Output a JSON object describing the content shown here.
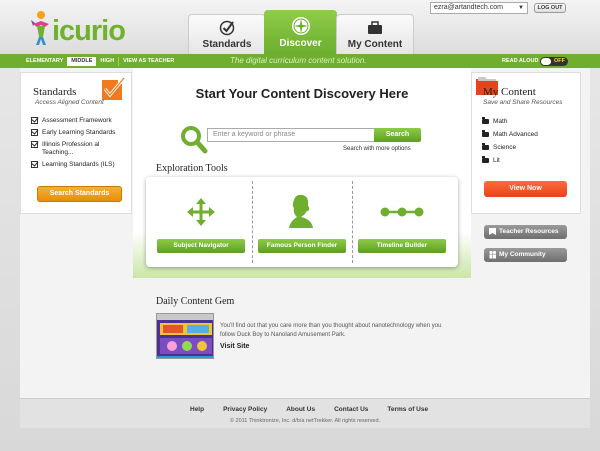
{
  "header": {
    "logo_text": "icurio",
    "tabs": [
      {
        "label": "Standards",
        "icon": "checkmark-circle-icon"
      },
      {
        "label": "Discover",
        "icon": "compass-icon"
      },
      {
        "label": "My Content",
        "icon": "briefcase-icon"
      }
    ],
    "account_email": "ezra@artandtech.com",
    "logout_label": "LOG OUT"
  },
  "levelbar": {
    "levels": [
      "ELEMENTARY",
      "MIDDLE",
      "HIGH",
      "VIEW AS TEACHER"
    ],
    "active_level": "MIDDLE",
    "tagline": "The digital curriculum content solution.",
    "read_aloud_label": "READ ALOUD",
    "read_aloud_state": "OFF"
  },
  "standards_panel": {
    "title": "Standards",
    "subtitle": "Access Aligned Content",
    "items": [
      "Assessment Framework",
      "Early Learning Standards",
      "Illinois Profession al Teaching...",
      "Learning Standards (ILS)"
    ],
    "button_label": "Search Standards"
  },
  "discover": {
    "heading": "Start Your Content Discovery Here",
    "search_placeholder": "Enter a keyword or phrase",
    "search_button": "Search",
    "search_more": "Search with more options",
    "tools_title": "Exploration Tools",
    "tools": [
      {
        "label": "Subject Navigator",
        "icon": "four-arrows-icon"
      },
      {
        "label": "Famous Person Finder",
        "icon": "person-silhouette-icon"
      },
      {
        "label": "Timeline Builder",
        "icon": "timeline-icon"
      }
    ]
  },
  "gem": {
    "title": "Daily Content Gem",
    "text": "You'll find out that you care more than you thought about nanotechnology when you follow Duck Boy to Nanoland Amusement Park.",
    "link_label": "Visit Site"
  },
  "my_content_panel": {
    "title": "My Content",
    "subtitle": "Save and Share Resources",
    "folders": [
      "Math",
      "Math Advanced",
      "Science",
      "Lit"
    ],
    "view_button": "View Now",
    "teacher_resources": "Teacher Resources",
    "my_community": "My Community"
  },
  "footer": {
    "links": [
      "Help",
      "Privacy Policy",
      "About Us",
      "Contact Us",
      "Terms of Use"
    ],
    "copyright": "© 2011 Thinktronize, Inc. d/b/a netTrekker. All rights reserved."
  },
  "colors": {
    "brand_green": "#6fae2f",
    "accent_orange": "#e58f0a",
    "accent_red": "#e8431a"
  }
}
